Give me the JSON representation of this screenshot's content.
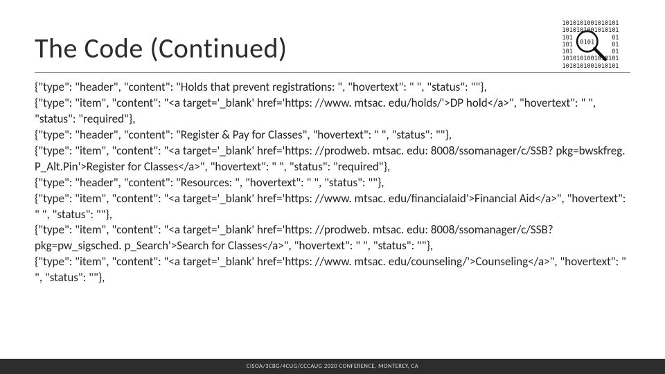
{
  "title": "The Code (Continued)",
  "icon_name": "binary-magnifier-icon",
  "body_lines": [
    "{\"type\": \"header\", \"content\": \"Holds that prevent registrations: \", \"hovertext\": \" \", \"status\": \"\"},",
    "{\"type\": \"item\", \"content\": \"<a target='_blank' href='https: //www. mtsac. edu/holds/'>DP hold</a>\", \"hovertext\": \" \", \"status\": \"required\"},",
    "{\"type\": \"header\", \"content\": \"Register & Pay for Classes\", \"hovertext\": \" \", \"status\": \"\"},",
    "{\"type\": \"item\", \"content\": \"<a target='_blank' href='https: //prodweb. mtsac. edu: 8008/ssomanager/c/SSB? pkg=bwskfreg. P_Alt.Pin'>Register for Classes</a>\", \"hovertext\": \" \", \"status\": \"required\"},",
    "{\"type\": \"header\", \"content\": \"Resources: \", \"hovertext\": \" \", \"status\": \"\"},",
    "{\"type\": \"item\", \"content\": \"<a target='_blank' href='https: //www. mtsac. edu/financialaid'>Financial Aid</a>\", \"hovertext\": \" \", \"status\": \"\"},",
    "{\"type\": \"item\", \"content\": \"<a target='_blank' href='https: //prodweb. mtsac. edu: 8008/ssomanager/c/SSB? pkg=pw_sigsched. p_Search'>Search for Classes</a>\", \"hovertext\": \" \", \"status\": \"\"},",
    "{\"type\": \"item\", \"content\": \"<a target='_blank' href='https: //www. mtsac. edu/counseling/'>Counseling</a>\", \"hovertext\": \" \", \"status\": \"\"},"
  ],
  "footer": "CISOA/3CBG/4CUG/CCCAUG 2020 CONFERENCE, MONTEREY, CA",
  "binary_rows": [
    "1010101001010101",
    "1010101001010101",
    "101           01",
    "101           01",
    "101           01",
    "1010101001010101",
    "1010101001010101"
  ]
}
